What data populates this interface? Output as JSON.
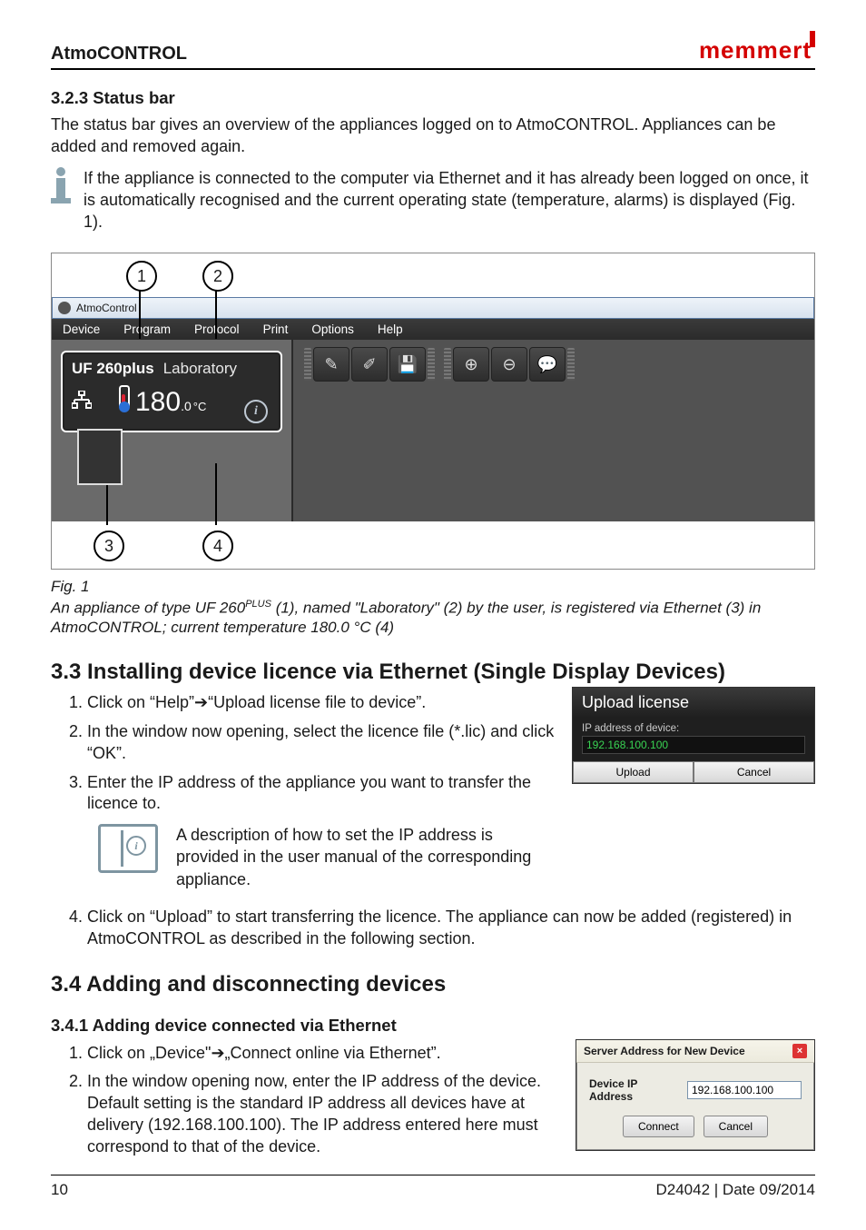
{
  "header": {
    "title": "AtmoCONTROL",
    "brand": "memmert"
  },
  "section_323": {
    "heading": "3.2.3  Status bar",
    "p1": "The status bar gives an overview of the appliances logged on to AtmoCONTROL. Appliances can be added and removed again.",
    "info": "If the appliance is connected to the computer via Ethernet and it has already been logged on once, it is automatically recognised and the current operating state (temperature, alarms) is displayed (Fig. 1)."
  },
  "fig1": {
    "callout1": "1",
    "callout2": "2",
    "callout3": "3",
    "callout4": "4",
    "window_title": "AtmoControl",
    "menu": [
      "Device",
      "Program",
      "Protocol",
      "Print",
      "Options",
      "Help"
    ],
    "device": {
      "model": "UF 260plus",
      "name": "Laboratory",
      "temp_int": "180",
      "temp_frac": ".0",
      "temp_unit": "°C"
    },
    "caption_label": "Fig. 1",
    "caption_pre": "An appliance of type UF 260",
    "caption_sup": "PLUS",
    "caption_post": " (1), named \"Laboratory\" (2) by the user, is registered via Ethernet (3) in AtmoCONTROL; current temperature 180.0 °C (4)"
  },
  "section_33": {
    "heading": "3.3   Installing device licence via Ethernet (Single Display Devices)",
    "step1_a": "Click on “Help”",
    "step1_b": "“Upload license file to device”.",
    "step2": "In the window now opening, select the licence file (*.lic) and click “OK”.",
    "step3": "Enter the IP address of the appliance you want to transfer the licence to.",
    "manual_note": "A description of how to set the IP address is provided in the user manual of the corresponding appliance.",
    "step4": "Click on “Upload” to start transferring the licence. The appliance can now be added (registered) in AtmoCONTROL as described in the following section."
  },
  "upload_dialog": {
    "title": "Upload license",
    "label": "IP address of device:",
    "value": "192.168.100.100",
    "btn_upload": "Upload",
    "btn_cancel": "Cancel"
  },
  "section_34": {
    "heading": "3.4   Adding and disconnecting devices",
    "sub_heading": "3.4.1  Adding device connected via Ethernet",
    "step1_a": "Click on „Device\"",
    "step1_b": "„Connect online via Ethernet”.",
    "step2": "In the window opening now, enter the IP address of the device. Default setting is the standard IP address all devices have at delivery (192.168.100.100). The IP address entered here must correspond to that of the device."
  },
  "server_dialog": {
    "title": "Server Address for New Device",
    "label": "Device IP Address",
    "value": "192.168.100.100",
    "btn_connect": "Connect",
    "btn_cancel": "Cancel"
  },
  "footer": {
    "page": "10",
    "doc": "D24042 | Date 09/2014"
  },
  "arrow": "➔"
}
